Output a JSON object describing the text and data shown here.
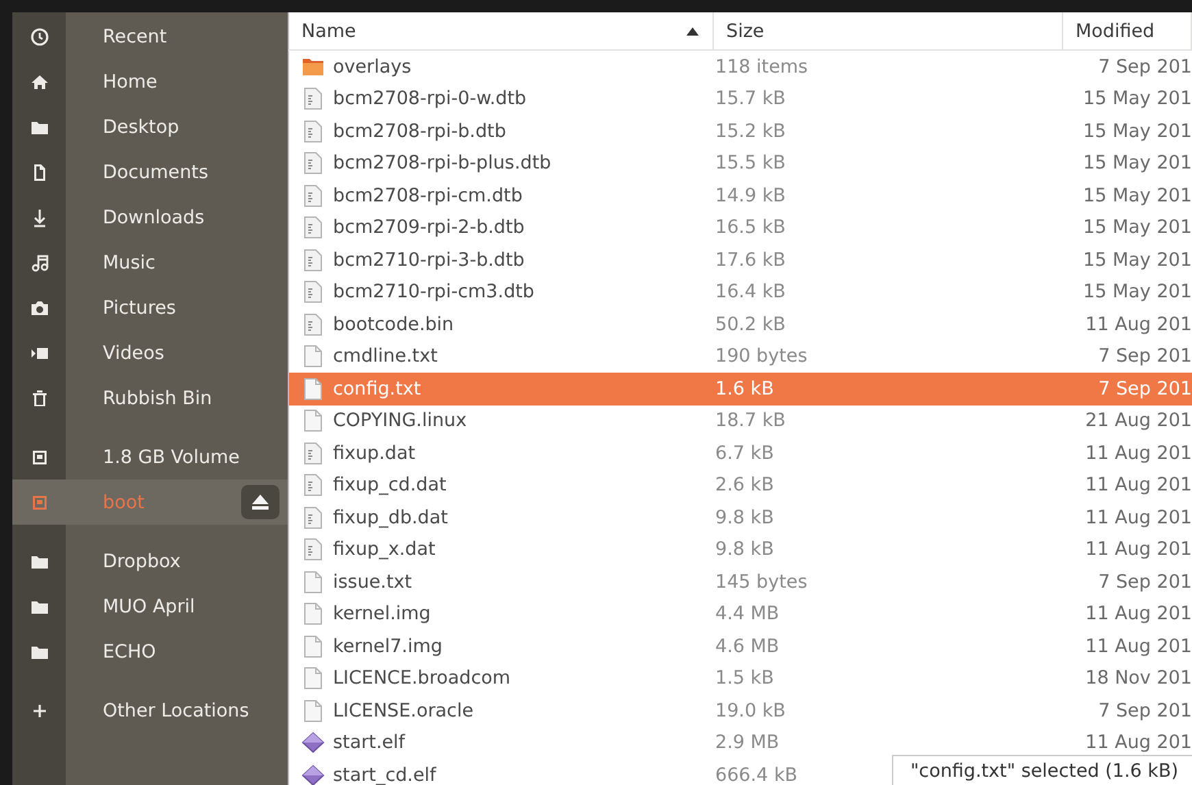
{
  "sidebar": {
    "groups": [
      {
        "items": [
          {
            "kind": "recent",
            "label": "Recent",
            "selected": false
          },
          {
            "kind": "home",
            "label": "Home",
            "selected": false
          },
          {
            "kind": "folder",
            "label": "Desktop",
            "selected": false
          },
          {
            "kind": "document",
            "label": "Documents",
            "selected": false
          },
          {
            "kind": "download",
            "label": "Downloads",
            "selected": false
          },
          {
            "kind": "music",
            "label": "Music",
            "selected": false
          },
          {
            "kind": "camera",
            "label": "Pictures",
            "selected": false
          },
          {
            "kind": "video",
            "label": "Videos",
            "selected": false
          },
          {
            "kind": "trash",
            "label": "Rubbish Bin",
            "selected": false
          }
        ]
      },
      {
        "items": [
          {
            "kind": "drive",
            "label": "1.8 GB Volume",
            "selected": false
          },
          {
            "kind": "drive",
            "label": "boot",
            "selected": true,
            "eject": true
          }
        ]
      },
      {
        "items": [
          {
            "kind": "folder",
            "label": "Dropbox",
            "selected": false
          },
          {
            "kind": "folder",
            "label": "MUO April",
            "selected": false
          },
          {
            "kind": "folder",
            "label": "ECHO",
            "selected": false
          }
        ]
      },
      {
        "items": [
          {
            "kind": "add",
            "label": "Other Locations",
            "selected": false
          }
        ]
      }
    ]
  },
  "table": {
    "columns": [
      {
        "label": "Name",
        "sorted": true
      },
      {
        "label": "Size",
        "sorted": false
      },
      {
        "label": "Modified",
        "sorted": false
      }
    ],
    "rows": [
      {
        "kind": "folder",
        "name": "overlays",
        "size": "118 items",
        "modified": "7 Sep 201",
        "selected": false
      },
      {
        "kind": "binary",
        "name": "bcm2708-rpi-0-w.dtb",
        "size": "15.7 kB",
        "modified": "15 May 201",
        "selected": false
      },
      {
        "kind": "binary",
        "name": "bcm2708-rpi-b.dtb",
        "size": "15.2 kB",
        "modified": "15 May 201",
        "selected": false
      },
      {
        "kind": "binary",
        "name": "bcm2708-rpi-b-plus.dtb",
        "size": "15.5 kB",
        "modified": "15 May 201",
        "selected": false
      },
      {
        "kind": "binary",
        "name": "bcm2708-rpi-cm.dtb",
        "size": "14.9 kB",
        "modified": "15 May 201",
        "selected": false
      },
      {
        "kind": "binary",
        "name": "bcm2709-rpi-2-b.dtb",
        "size": "16.5 kB",
        "modified": "15 May 201",
        "selected": false
      },
      {
        "kind": "binary",
        "name": "bcm2710-rpi-3-b.dtb",
        "size": "17.6 kB",
        "modified": "15 May 201",
        "selected": false
      },
      {
        "kind": "binary",
        "name": "bcm2710-rpi-cm3.dtb",
        "size": "16.4 kB",
        "modified": "15 May 201",
        "selected": false
      },
      {
        "kind": "binary",
        "name": "bootcode.bin",
        "size": "50.2 kB",
        "modified": "11 Aug 201",
        "selected": false
      },
      {
        "kind": "text",
        "name": "cmdline.txt",
        "size": "190 bytes",
        "modified": "7 Sep 201",
        "selected": false
      },
      {
        "kind": "text",
        "name": "config.txt",
        "size": "1.6 kB",
        "modified": "7 Sep 201",
        "selected": true
      },
      {
        "kind": "text",
        "name": "COPYING.linux",
        "size": "18.7 kB",
        "modified": "21 Aug 201",
        "selected": false
      },
      {
        "kind": "binary",
        "name": "fixup.dat",
        "size": "6.7 kB",
        "modified": "11 Aug 201",
        "selected": false
      },
      {
        "kind": "binary",
        "name": "fixup_cd.dat",
        "size": "2.6 kB",
        "modified": "11 Aug 201",
        "selected": false
      },
      {
        "kind": "binary",
        "name": "fixup_db.dat",
        "size": "9.8 kB",
        "modified": "11 Aug 201",
        "selected": false
      },
      {
        "kind": "binary",
        "name": "fixup_x.dat",
        "size": "9.8 kB",
        "modified": "11 Aug 201",
        "selected": false
      },
      {
        "kind": "text",
        "name": "issue.txt",
        "size": "145 bytes",
        "modified": "7 Sep 201",
        "selected": false
      },
      {
        "kind": "text",
        "name": "kernel.img",
        "size": "4.4 MB",
        "modified": "11 Aug 201",
        "selected": false
      },
      {
        "kind": "text",
        "name": "kernel7.img",
        "size": "4.6 MB",
        "modified": "11 Aug 201",
        "selected": false
      },
      {
        "kind": "text",
        "name": "LICENCE.broadcom",
        "size": "1.5 kB",
        "modified": "18 Nov 201",
        "selected": false
      },
      {
        "kind": "text",
        "name": "LICENSE.oracle",
        "size": "19.0 kB",
        "modified": "7 Sep 201",
        "selected": false
      },
      {
        "kind": "executable",
        "name": "start.elf",
        "size": "2.9 MB",
        "modified": "11 Aug 201",
        "selected": false
      },
      {
        "kind": "executable",
        "name": "start_cd.elf",
        "size": "666.4 kB",
        "selected": false
      }
    ]
  },
  "status_bar": {
    "text": "\"config.txt\" selected  (1.6 kB)"
  }
}
